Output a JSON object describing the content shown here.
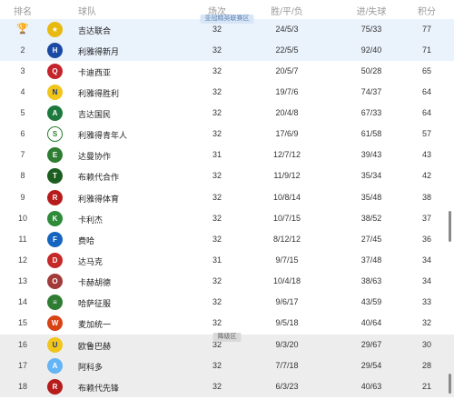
{
  "header": {
    "rank": "排名",
    "team": "球队",
    "played": "场次",
    "wdl": "胜/平/负",
    "goals": "进/失球",
    "points": "积分"
  },
  "zones": {
    "afc": "亚冠精英联赛区",
    "relegation": "降级区"
  },
  "colors": {
    "afc_row": "#eaf2fc",
    "relegation_row": "#ededed",
    "zone_label_blue": "#d7e6f7",
    "zone_label_gray": "#d9d9d9"
  },
  "rows": [
    {
      "rank": "",
      "rank_icon": "trophy-icon",
      "team": "吉达联合",
      "played": "32",
      "wdl": "24/5/3",
      "goals": "75/33",
      "points": "77",
      "logo_color": "#e8b90e",
      "logo_glyph": "★",
      "zone": "afc"
    },
    {
      "rank": "2",
      "team": "利雅得新月",
      "played": "32",
      "wdl": "22/5/5",
      "goals": "92/40",
      "points": "71",
      "logo_color": "#1a4aa3",
      "logo_glyph": "H",
      "zone": "afc"
    },
    {
      "rank": "3",
      "team": "卡迪西亚",
      "played": "32",
      "wdl": "20/5/7",
      "goals": "50/28",
      "points": "65",
      "logo_color": "#c4242b",
      "logo_glyph": "Q",
      "zone": ""
    },
    {
      "rank": "4",
      "team": "利雅得胜利",
      "played": "32",
      "wdl": "19/7/6",
      "goals": "74/37",
      "points": "64",
      "logo_color": "#f2c51b",
      "logo_glyph": "N",
      "zone": ""
    },
    {
      "rank": "5",
      "team": "吉达国民",
      "played": "32",
      "wdl": "20/4/8",
      "goals": "67/33",
      "points": "64",
      "logo_color": "#1b7a3c",
      "logo_glyph": "A",
      "zone": ""
    },
    {
      "rank": "6",
      "team": "利雅得青年人",
      "played": "32",
      "wdl": "17/6/9",
      "goals": "61/58",
      "points": "57",
      "logo_color": "#ffffff",
      "logo_glyph": "S",
      "zone": ""
    },
    {
      "rank": "7",
      "team": "达曼协作",
      "played": "31",
      "wdl": "12/7/12",
      "goals": "39/43",
      "points": "43",
      "logo_color": "#2e7d32",
      "logo_glyph": "E",
      "zone": ""
    },
    {
      "rank": "8",
      "team": "布赖代合作",
      "played": "32",
      "wdl": "11/9/12",
      "goals": "35/34",
      "points": "42",
      "logo_color": "#1b5e20",
      "logo_glyph": "T",
      "zone": ""
    },
    {
      "rank": "9",
      "team": "利雅得体育",
      "played": "32",
      "wdl": "10/8/14",
      "goals": "35/48",
      "points": "38",
      "logo_color": "#b71c1c",
      "logo_glyph": "R",
      "zone": ""
    },
    {
      "rank": "10",
      "team": "卡利杰",
      "played": "32",
      "wdl": "10/7/15",
      "goals": "38/52",
      "points": "37",
      "logo_color": "#2e8b3a",
      "logo_glyph": "K",
      "zone": ""
    },
    {
      "rank": "11",
      "team": "费哈",
      "played": "32",
      "wdl": "8/12/12",
      "goals": "27/45",
      "points": "36",
      "logo_color": "#1565c0",
      "logo_glyph": "F",
      "zone": ""
    },
    {
      "rank": "12",
      "team": "达马克",
      "played": "31",
      "wdl": "9/7/15",
      "goals": "37/48",
      "points": "34",
      "logo_color": "#c62828",
      "logo_glyph": "D",
      "zone": ""
    },
    {
      "rank": "13",
      "team": "卡赫胡德",
      "played": "32",
      "wdl": "10/4/18",
      "goals": "38/63",
      "points": "34",
      "logo_color": "#a33a3a",
      "logo_glyph": "O",
      "zone": ""
    },
    {
      "rank": "14",
      "team": "哈萨征服",
      "played": "32",
      "wdl": "9/6/17",
      "goals": "43/59",
      "points": "33",
      "logo_color": "#2e7d32",
      "logo_glyph": "≡",
      "zone": ""
    },
    {
      "rank": "15",
      "team": "麦加统一",
      "played": "32",
      "wdl": "9/5/18",
      "goals": "40/64",
      "points": "32",
      "logo_color": "#d84315",
      "logo_glyph": "W",
      "zone": ""
    },
    {
      "rank": "16",
      "team": "欧鲁巴赫",
      "played": "32",
      "wdl": "9/3/20",
      "goals": "29/67",
      "points": "30",
      "logo_color": "#f2c51b",
      "logo_glyph": "U",
      "zone": "rel"
    },
    {
      "rank": "17",
      "team": "阿科多",
      "played": "32",
      "wdl": "7/7/18",
      "goals": "29/54",
      "points": "28",
      "logo_color": "#64b5f6",
      "logo_glyph": "A",
      "zone": "rel"
    },
    {
      "rank": "18",
      "team": "布赖代先锋",
      "played": "32",
      "wdl": "6/3/23",
      "goals": "40/63",
      "points": "21",
      "logo_color": "#b71c1c",
      "logo_glyph": "R",
      "zone": "rel"
    }
  ]
}
